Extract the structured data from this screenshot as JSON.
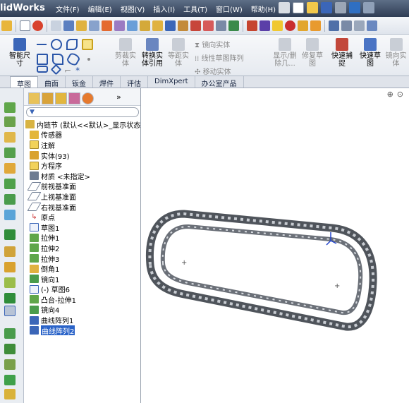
{
  "app": {
    "title": "lidWorks"
  },
  "menu": [
    "文件(F)",
    "编辑(E)",
    "视图(V)",
    "插入(I)",
    "工具(T)",
    "窗口(W)",
    "帮助(H)"
  ],
  "ribbon": {
    "smart_dim": "智能尺\n寸",
    "trim": "剪裁实\n体",
    "convert": "转换实\n体引用",
    "offset": "等距实\n体",
    "mirror": "镜向实体",
    "linear_pattern": "线性草图阵列",
    "move": "移动实体",
    "show_hide": "显示/删\n除几...",
    "repair": "修复草\n图",
    "quick_snap": "快速捕\n捉",
    "rapid_sketch": "快速草\n图",
    "mirror2": "镜向实\n体"
  },
  "tabs": [
    "草图",
    "曲面",
    "钣金",
    "焊件",
    "评估",
    "DimXpert",
    "办公室产品"
  ],
  "tree": {
    "root": "内链节  (默认<<默认>_显示状态 1>",
    "items": [
      "传感器",
      "注解",
      "实体(93)",
      "方程序",
      "材质 <未指定>",
      "前视基准面",
      "上视基准面",
      "右视基准面",
      "原点",
      "草图1",
      "拉伸1",
      "拉伸2",
      "拉伸3",
      "倒角1",
      "镜向1",
      "(-) 草图6",
      "凸台-拉伸1",
      "镜向4",
      "曲线阵列1",
      "曲线阵列2"
    ],
    "selected_index": 19
  },
  "colors": {
    "title_bar": "#3c4a63",
    "selection": "#2a63c8",
    "chain": "#5d6269"
  }
}
